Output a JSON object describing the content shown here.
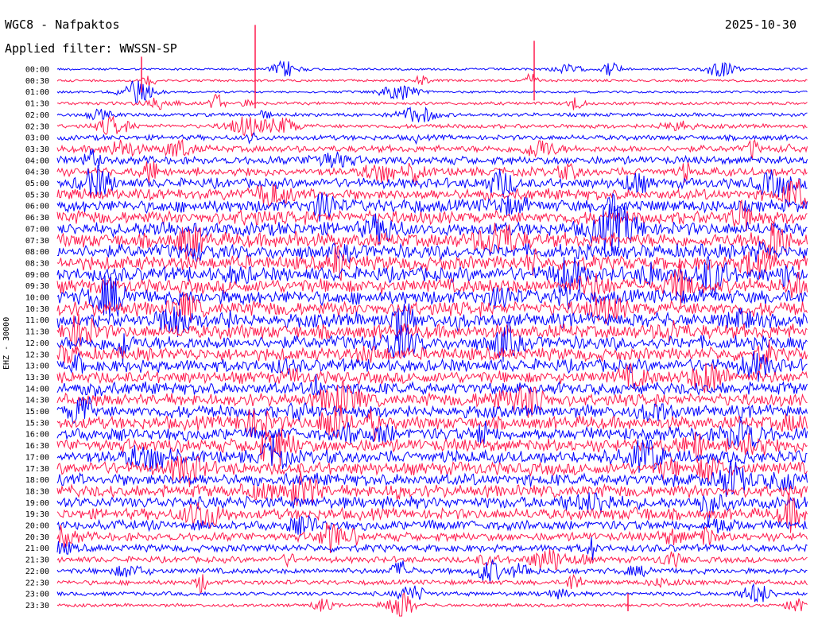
{
  "header": {
    "station": "WGC8 - Nafpaktos",
    "date": "2025-10-30",
    "filter": "Applied filter: WWSSN-SP"
  },
  "chart_data": {
    "type": "line",
    "title": "WGC8 - Nafpaktos",
    "ylabel": "EHZ - 30000",
    "time_labels": [
      "00:00",
      "00:30",
      "01:00",
      "01:30",
      "02:00",
      "02:30",
      "03:00",
      "03:30",
      "04:00",
      "04:30",
      "05:00",
      "05:30",
      "06:00",
      "06:30",
      "07:00",
      "07:30",
      "08:00",
      "08:30",
      "09:00",
      "09:30",
      "10:00",
      "10:30",
      "11:00",
      "11:30",
      "12:00",
      "12:30",
      "13:00",
      "13:30",
      "14:00",
      "14:30",
      "15:00",
      "15:30",
      "16:00",
      "16:30",
      "17:00",
      "17:30",
      "18:00",
      "18:30",
      "19:00",
      "19:30",
      "20:00",
      "20:30",
      "21:00",
      "21:30",
      "22:00",
      "22:30",
      "23:00",
      "23:30"
    ],
    "colors": [
      "#0000ff",
      "#ff1a4d"
    ],
    "activity_level": [
      0.05,
      0.06,
      0.05,
      0.12,
      0.16,
      0.2,
      0.28,
      0.4,
      0.5,
      0.55,
      0.65,
      0.75,
      0.85,
      0.9,
      0.95,
      1.0,
      1.0,
      1.0,
      1.0,
      1.0,
      1.0,
      1.0,
      1.0,
      1.0,
      0.95,
      0.9,
      0.88,
      0.85,
      0.85,
      0.85,
      0.85,
      0.9,
      0.9,
      0.9,
      0.9,
      0.88,
      0.85,
      0.82,
      0.8,
      0.75,
      0.65,
      0.55,
      0.45,
      0.35,
      0.3,
      0.25,
      0.2,
      0.12
    ]
  }
}
